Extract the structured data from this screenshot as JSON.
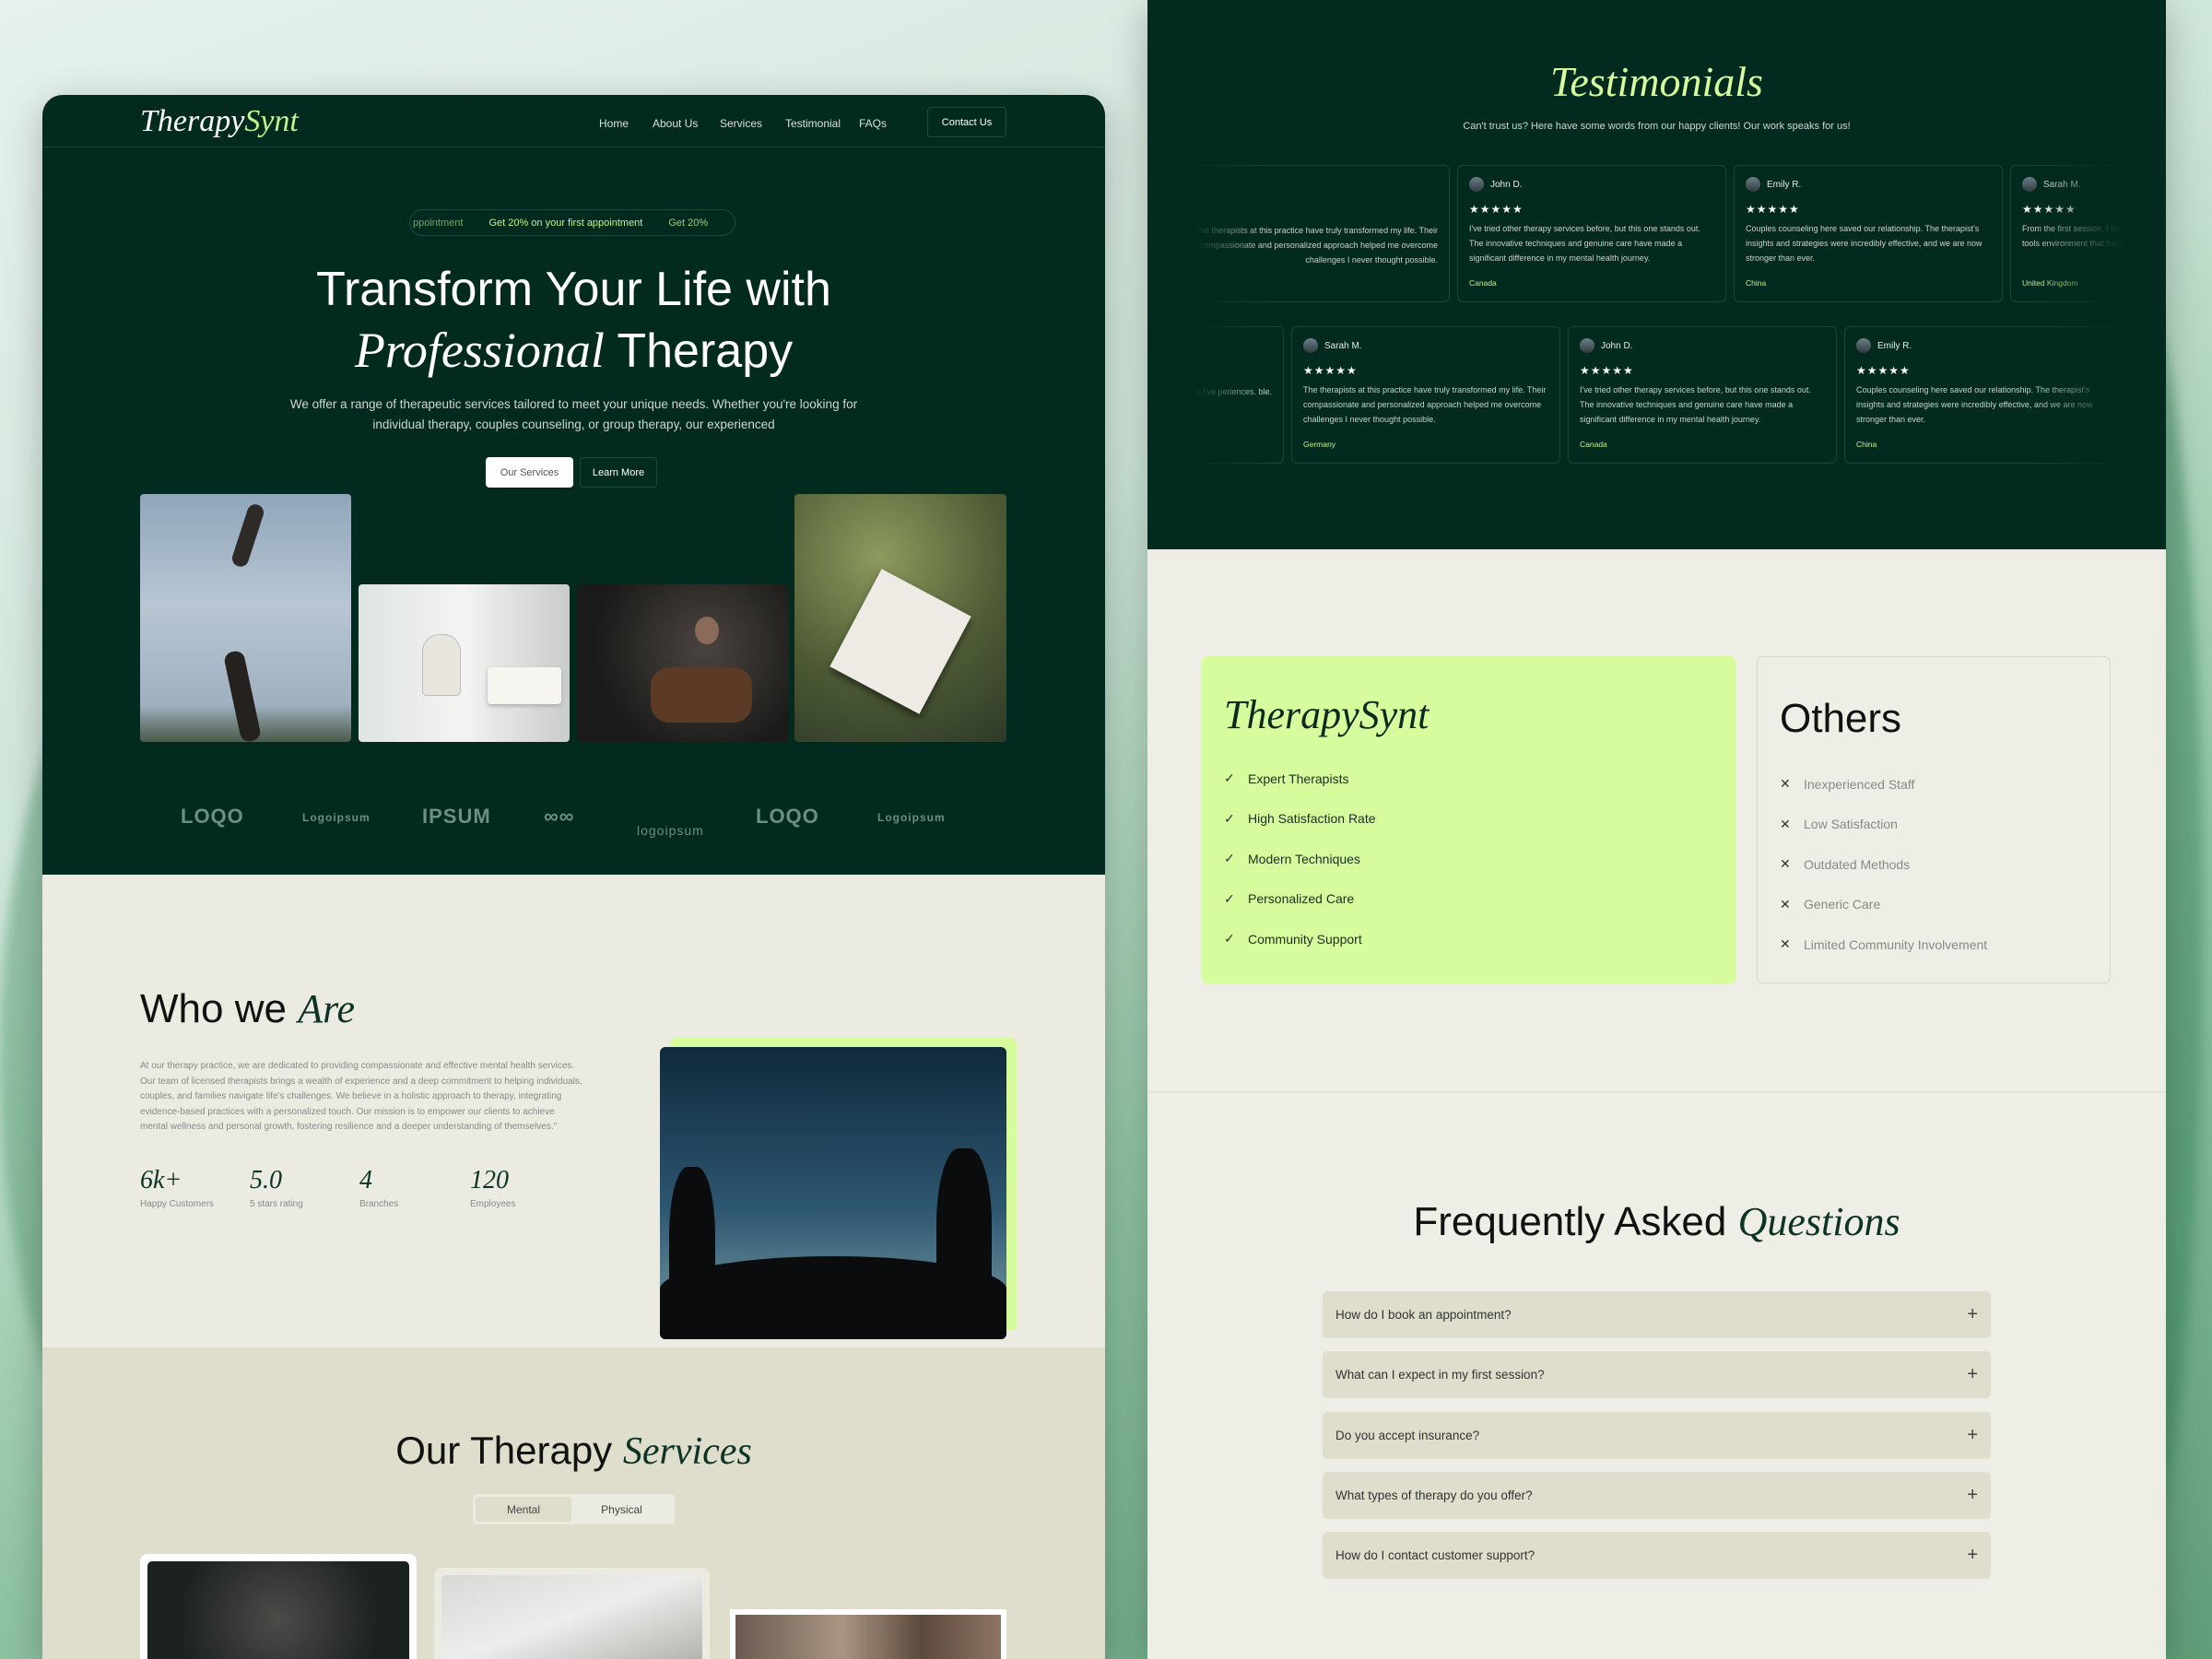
{
  "brand": {
    "name_a": "Therapy",
    "name_b": "Synt"
  },
  "nav": {
    "items": [
      "Home",
      "About Us",
      "Services",
      "Testimonial",
      "FAQs"
    ],
    "contact": "Contact Us"
  },
  "hero": {
    "promo": [
      "ppointment",
      "Get 20% on your first appointment",
      "Get 20%"
    ],
    "title_line1": "Transform Your Life with",
    "title_italic": "Professional",
    "title_rest": "Therapy",
    "subtitle_line1": "We offer a range of therapeutic services tailored to meet your unique needs. Whether you're looking for",
    "subtitle_line2": "individual therapy, couples counseling, or group therapy, our experienced",
    "btn_primary": "Our Services",
    "btn_secondary": "Learn More"
  },
  "logos": [
    "LOQO",
    "Logoipsum",
    "IPSUM",
    "∞∞",
    "logoipsum",
    "LOQO",
    "Logoipsum"
  ],
  "about": {
    "title": "Who we",
    "title_italic": "Are",
    "body": "At our therapy practice, we are dedicated to providing compassionate and effective mental health services. Our team of licensed therapists brings a wealth of experience and a deep commitment to helping individuals, couples, and families navigate life's challenges. We believe in a holistic approach to therapy, integrating evidence-based practices with a personalized touch. Our mission is to empower our clients to achieve mental wellness and personal growth, fostering resilience and a deeper understanding of themselves.\"",
    "stats": [
      {
        "value": "6k+",
        "label": "Happy Customers"
      },
      {
        "value": "5.0",
        "label": "5 stars rating"
      },
      {
        "value": "4",
        "label": "Branches"
      },
      {
        "value": "120",
        "label": "Employees"
      }
    ]
  },
  "services": {
    "title": "Our Therapy",
    "title_italic": "Services",
    "tabs": [
      "Mental",
      "Physical"
    ],
    "active_tab": "Mental"
  },
  "testimonials": {
    "title": "Testimonials",
    "subtitle": "Can't trust us? Here have some words from our happy clients! Our work speaks for us!",
    "rating": "★★★★★",
    "row1": [
      {
        "name": "",
        "text": "The therapists at this practice have truly transformed my life. Their compassionate and personalized approach helped me overcome challenges I never thought possible.",
        "country": ""
      },
      {
        "name": "John D.",
        "text": "I've tried other therapy services before, but this one stands out. The innovative techniques and genuine care have made a significant difference in my mental health journey.",
        "country": "Canada"
      },
      {
        "name": "Emily R.",
        "text": "Couples counseling here saved our relationship. The therapist's insights and strategies were incredibly effective, and we are now stronger than ever.",
        "country": "China"
      },
      {
        "name": "Sarah M.",
        "text": "From the first session, I felt heard. The therapist provided practical tools environment that have greatly im",
        "country": "United Kingdom"
      }
    ],
    "row2": [
      {
        "name": "",
        "text": "sions I've periences. ble.",
        "country": ""
      },
      {
        "name": "Sarah M.",
        "text": "The therapists at this practice have truly transformed my life. Their compassionate and personalized approach helped me overcome challenges I never thought possible.",
        "country": "Germany"
      },
      {
        "name": "John D.",
        "text": "I've tried other therapy services before, but this one stands out. The innovative techniques and genuine care have made a significant difference in my mental health journey.",
        "country": "Canada"
      },
      {
        "name": "Emily R.",
        "text": "Couples counseling here saved our relationship. The therapist's insights and strategies were incredibly effective, and we are now stronger than ever.",
        "country": "China"
      }
    ]
  },
  "comparison": {
    "ours_title": "TherapySynt",
    "ours": [
      "Expert Therapists",
      "High Satisfaction Rate",
      "Modern Techniques",
      "Personalized Care",
      "Community Support"
    ],
    "others_title": "Others",
    "others": [
      "Inexperienced Staff",
      "Low Satisfaction",
      "Outdated Methods",
      "Generic Care",
      "Limited Community Involvement"
    ]
  },
  "faq": {
    "title": "Frequently Asked",
    "title_italic": "Questions",
    "items": [
      "How do I book an appointment?",
      "What can I expect in my first session?",
      "Do you accept insurance?",
      "What types of therapy do you offer?",
      "How do I contact customer support?"
    ]
  },
  "colors": {
    "dark_green": "#032a1f",
    "lime": "#d6fc9d",
    "accent_text": "#c7f08f",
    "cream": "#efeee6",
    "sand": "#dfddcb"
  }
}
